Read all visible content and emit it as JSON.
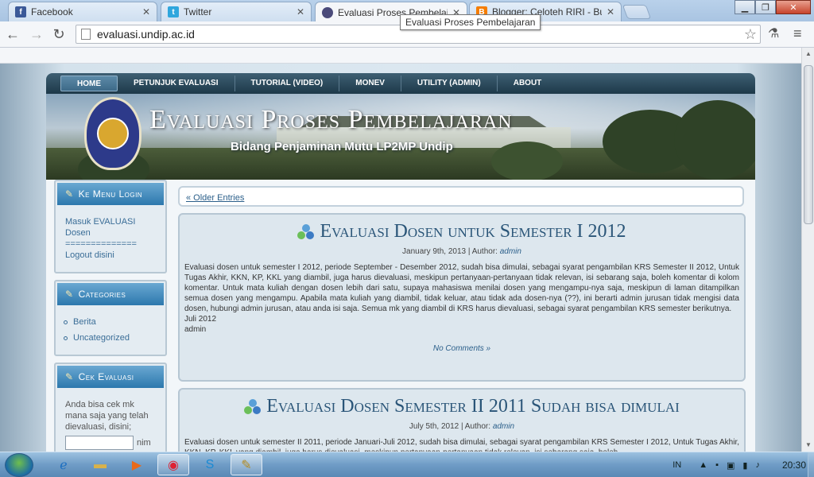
{
  "browser": {
    "tabs": [
      {
        "label": "Facebook",
        "icon": "facebook-icon",
        "color": "#3b5998",
        "active": false
      },
      {
        "label": "Twitter",
        "icon": "twitter-icon",
        "color": "#2fa6dd",
        "active": false
      },
      {
        "label": "Evaluasi Proses Pembelaja",
        "icon": "undip-seal-icon",
        "color": "#4a4a7a",
        "active": true
      },
      {
        "label": "Blogger: Celoteh RIRI - Bu",
        "icon": "blogger-icon",
        "color": "#f57d00",
        "active": false
      }
    ],
    "tooltip": "Evaluasi Proses Pembelajaran",
    "url": "evaluasi.undip.ac.id"
  },
  "site": {
    "nav": [
      "HOME",
      "PETUNJUK EVALUASI",
      "TUTORIAL (VIDEO)",
      "MONEV",
      "UTILITY (ADMIN)",
      "ABOUT"
    ],
    "title": "Evaluasi Proses Pembelajaran",
    "subtitle": "Bidang Penjaminan Mutu LP2MP Undip",
    "older_entries": "« Older Entries"
  },
  "sidebar": {
    "login": {
      "title": "Ke Menu Login",
      "link1": "Masuk EVALUASI Dosen",
      "separator": "==============",
      "link2": "Logout disini"
    },
    "categories": {
      "title": "Categories",
      "items": [
        "Berita",
        "Uncategorized"
      ]
    },
    "cek": {
      "title": "Cek Evaluasi",
      "text": "Anda bisa cek mk mana saja yang telah dievaluasi, disini;",
      "input_suffix": "nim"
    }
  },
  "posts": [
    {
      "title": "Evaluasi Dosen untuk Semester I 2012",
      "date": "January 9th, 2013",
      "author_label": "Author:",
      "author": "admin",
      "body": "Evaluasi dosen untuk semester I 2012, periode September - Desember 2012, sudah bisa dimulai, sebagai syarat pengambilan KRS Semester II 2012, Untuk Tugas Akhir, KKN, KP, KKL yang diambil, juga harus dievaluasi, meskipun pertanyaan-pertanyaan tidak relevan, isi sebarang saja, boleh komentar di kolom komentar. Untuk mata kuliah dengan dosen lebih dari satu, supaya mahasiswa menilai dosen yang mengampu-nya saja, meskipun di laman ditampilkan semua dosen yang mengampu. Apabila mata kuliah yang diambil, tidak keluar, atau tidak ada dosen-nya (??), ini berarti admin jurusan tidak mengisi data dosen, hubungi admin jurusan, atau anda isi saja. Semua mk yang diambil di KRS harus dievaluasi, sebagai syarat pengambilan KRS semester berikutnya.",
      "line2": "Juli 2012",
      "line3": "admin",
      "footer": "No Comments »"
    },
    {
      "title": "Evaluasi Dosen Semester II 2011 Sudah bisa dimulai",
      "date": "July 5th, 2012",
      "author_label": "Author:",
      "author": "admin",
      "body": "Evaluasi dosen untuk semester II 2011, periode Januari-Juli 2012, sudah bisa dimulai, sebagai syarat pengambilan KRS Semester I 2012, Untuk Tugas Akhir, KKN, KP, KKL yang diambil, juga harus dievaluasi, meskipun pertanyaan-pertanyaan tidak relevan, isi sebarang saja, boleh"
    }
  ],
  "taskbar": {
    "apps": [
      "ie-icon",
      "explorer-icon",
      "media-player-icon",
      "chrome-icon",
      "skype-icon",
      "misc-app-icon"
    ],
    "lang": "IN",
    "time": "20:30"
  }
}
